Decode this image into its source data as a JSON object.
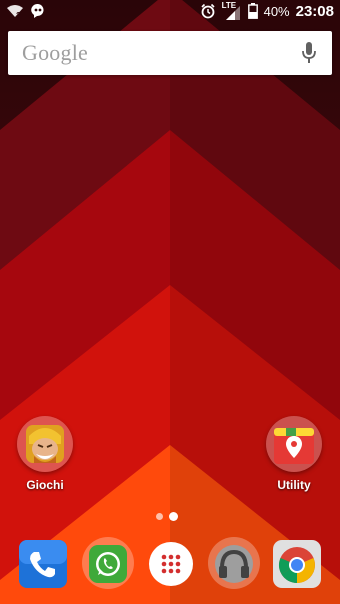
{
  "status_bar": {
    "left_icons": [
      "wifi-unknown-icon",
      "hangouts-icon"
    ],
    "alarm_icon": "alarm-clock-icon",
    "network_type": "LTE",
    "signal_icon": "cell-signal-icon",
    "battery_percent": "40%",
    "time": "23:08"
  },
  "search_widget": {
    "brand": "Google",
    "mic_icon": "microphone-icon"
  },
  "home_apps": [
    {
      "label": "Giochi",
      "icon": "clash-of-clans-folder-icon"
    },
    {
      "label": "Utility",
      "icon": "maps-folder-icon"
    }
  ],
  "pager": {
    "page_count": 2,
    "current_page": 2
  },
  "dock": [
    {
      "app": "phone",
      "icon": "phone-icon"
    },
    {
      "app": "whatsapp",
      "icon": "whatsapp-icon"
    },
    {
      "app": "app-drawer",
      "icon": "app-drawer-icon"
    },
    {
      "app": "music",
      "icon": "headphones-icon"
    },
    {
      "app": "chrome",
      "icon": "chrome-icon"
    }
  ],
  "colors": {
    "wallpaper_dark": "#3a070c",
    "wallpaper_mid": "#b3050b",
    "wallpaper_bright": "#ff3d0a",
    "search_text": "#9e9e9e"
  }
}
